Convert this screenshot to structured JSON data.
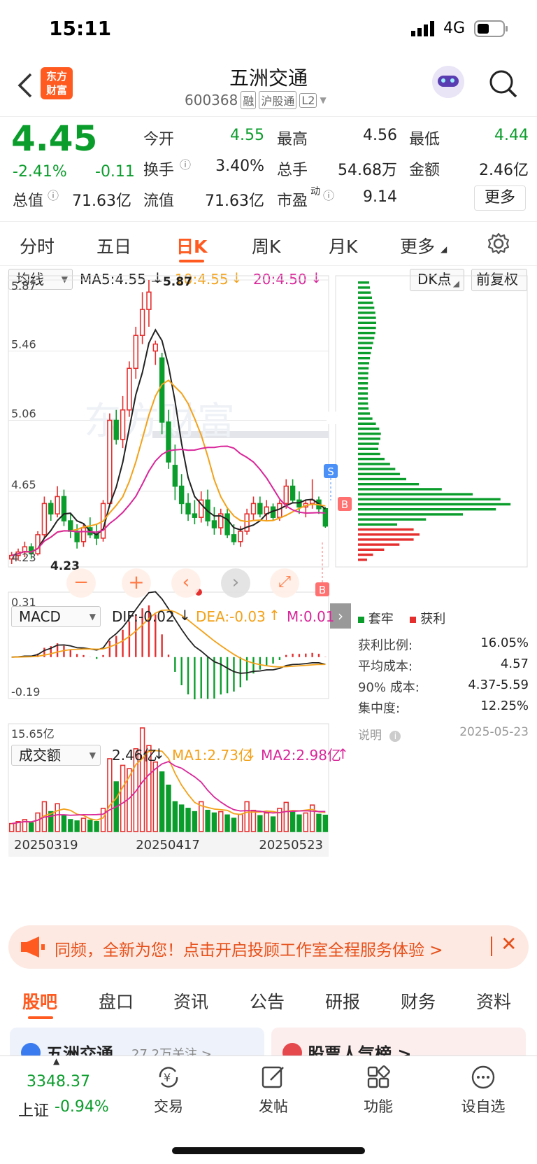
{
  "status": {
    "time": "15:11",
    "network": "4G"
  },
  "nav": {
    "title": "五洲交通",
    "code": "600368",
    "badges": [
      "融",
      "沪股通",
      "L2"
    ],
    "logo_text": "东方财富"
  },
  "quote": {
    "price": "4.45",
    "pct": "-2.41%",
    "chg": "-0.11",
    "fields": [
      {
        "label": "今开",
        "value": "4.55",
        "tone": "green"
      },
      {
        "label": "最高",
        "value": "4.56",
        "tone": "black"
      },
      {
        "label": "最低",
        "value": "4.44",
        "tone": "green"
      },
      {
        "label": "换手",
        "value": "3.40%",
        "tone": "black"
      },
      {
        "label": "总手",
        "value": "54.68万",
        "tone": "black"
      },
      {
        "label": "金额",
        "value": "2.46亿",
        "tone": "black"
      },
      {
        "label": "总值",
        "value": "71.63亿",
        "tone": "black"
      },
      {
        "label": "流值",
        "value": "71.63亿",
        "tone": "black"
      },
      {
        "label": "市盈",
        "sup": "动",
        "value": "9.14",
        "tone": "black"
      }
    ],
    "more_button": "更多"
  },
  "ktabs": [
    "分时",
    "五日",
    "日K",
    "周K",
    "月K",
    "更多"
  ],
  "ktabs_active": "日K",
  "ma": {
    "selector": "均线",
    "ma5": "MA5:4.55",
    "ma10": "10:4.55",
    "ma20": "20:4.50",
    "dk_label": "DK点",
    "adjust_label": "前复权",
    "y_labels": [
      "5.87",
      "5.46",
      "5.06",
      "4.65",
      "4.23"
    ],
    "high_mark": "5.87",
    "low_mark": "4.23",
    "signal_s": "S",
    "signal_b": "B",
    "watermark": "东方财富"
  },
  "macd": {
    "selector": "MACD",
    "dif": "DIF:-0.02",
    "dea": "DEA:-0.03",
    "m": "M:0.01",
    "y_top": "0.31",
    "y_bottom": "-0.19"
  },
  "volume": {
    "selector": "成交额",
    "value": "2.46亿",
    "ma1": "MA1:2.73亿",
    "ma2": "MA2:2.98亿",
    "y_top": "15.65亿",
    "dates": [
      "20250319",
      "20250417",
      "20250523"
    ]
  },
  "chips": {
    "legend_hold": "套牢",
    "legend_profit": "获利",
    "rows": [
      {
        "label": "获利比例:",
        "value": "16.05%"
      },
      {
        "label": "平均成本:",
        "value": "4.57"
      },
      {
        "label": "90% 成本:",
        "value": "4.37-5.59"
      },
      {
        "label": "集中度:",
        "value": "12.25%"
      }
    ],
    "note_label": "说明",
    "date": "2025-05-23"
  },
  "banner": {
    "text": "同频，全新为您！点击开启投顾工作室全程服务体验 >"
  },
  "bottom_tabs": [
    "股吧",
    "盘口",
    "资讯",
    "公告",
    "研报",
    "财务",
    "资料"
  ],
  "bottom_tabs_active": "股吧",
  "peek": {
    "left": "五洲交通",
    "left_sub": "27.2万关注 >",
    "right": "股票人气榜 >"
  },
  "tabbar": {
    "index_value": "3348.37",
    "index_name": "上证",
    "index_pct": "-0.94%",
    "items": [
      "交易",
      "发帖",
      "功能",
      "设自选"
    ]
  },
  "colors": {
    "up": "#e52f2f",
    "down": "#0b9d2c",
    "ma5": "#222222",
    "ma10": "#f3a21a",
    "ma20": "#d9279a",
    "accent": "#ff5a1f"
  },
  "chart_data": {
    "type": "candlestick",
    "ylim": [
      4.23,
      5.87
    ],
    "ohlc": [
      [
        4.26,
        4.3,
        4.23,
        4.28
      ],
      [
        4.28,
        4.32,
        4.25,
        4.3
      ],
      [
        4.3,
        4.36,
        4.27,
        4.33
      ],
      [
        4.33,
        4.35,
        4.26,
        4.29
      ],
      [
        4.29,
        4.42,
        4.28,
        4.4
      ],
      [
        4.4,
        4.62,
        4.38,
        4.58
      ],
      [
        4.58,
        4.6,
        4.48,
        4.52
      ],
      [
        4.52,
        4.68,
        4.5,
        4.62
      ],
      [
        4.62,
        4.66,
        4.45,
        4.48
      ],
      [
        4.48,
        4.52,
        4.38,
        4.42
      ],
      [
        4.42,
        4.46,
        4.32,
        4.36
      ],
      [
        4.36,
        4.46,
        4.33,
        4.44
      ],
      [
        4.44,
        4.5,
        4.38,
        4.4
      ],
      [
        4.4,
        4.46,
        4.34,
        4.38
      ],
      [
        4.38,
        4.6,
        4.36,
        4.58
      ],
      [
        4.58,
        5.1,
        4.56,
        5.06
      ],
      [
        5.06,
        5.12,
        4.92,
        4.95
      ],
      [
        4.95,
        5.2,
        4.9,
        5.12
      ],
      [
        5.12,
        5.4,
        5.08,
        5.36
      ],
      [
        5.36,
        5.6,
        5.3,
        5.55
      ],
      [
        5.55,
        5.8,
        5.5,
        5.7
      ],
      [
        5.7,
        5.87,
        5.6,
        5.8
      ],
      [
        5.46,
        5.52,
        5.38,
        5.5
      ],
      [
        5.42,
        5.45,
        4.98,
        5.05
      ],
      [
        5.05,
        5.12,
        4.78,
        4.82
      ],
      [
        4.8,
        4.92,
        4.6,
        4.68
      ],
      [
        4.68,
        4.75,
        4.52,
        4.58
      ],
      [
        4.58,
        4.64,
        4.48,
        4.52
      ],
      [
        4.52,
        4.6,
        4.46,
        4.5
      ],
      [
        4.5,
        4.65,
        4.47,
        4.6
      ],
      [
        4.6,
        4.66,
        4.45,
        4.48
      ],
      [
        4.48,
        4.56,
        4.4,
        4.44
      ],
      [
        4.44,
        4.55,
        4.4,
        4.52
      ],
      [
        4.52,
        4.55,
        4.38,
        4.4
      ],
      [
        4.4,
        4.46,
        4.34,
        4.36
      ],
      [
        4.36,
        4.45,
        4.33,
        4.42
      ],
      [
        4.42,
        4.55,
        4.4,
        4.52
      ],
      [
        4.52,
        4.62,
        4.48,
        4.58
      ],
      [
        4.58,
        4.62,
        4.5,
        4.52
      ],
      [
        4.52,
        4.6,
        4.48,
        4.56
      ],
      [
        4.56,
        4.58,
        4.48,
        4.5
      ],
      [
        4.5,
        4.6,
        4.48,
        4.58
      ],
      [
        4.58,
        4.72,
        4.55,
        4.68
      ],
      [
        4.68,
        4.72,
        4.58,
        4.6
      ],
      [
        4.6,
        4.65,
        4.52,
        4.56
      ],
      [
        4.56,
        4.6,
        4.5,
        4.58
      ],
      [
        4.58,
        4.72,
        4.55,
        4.6
      ],
      [
        4.6,
        4.62,
        4.52,
        4.55
      ],
      [
        4.55,
        4.56,
        4.44,
        4.45
      ]
    ],
    "volume_yi": [
      1.2,
      1.5,
      1.8,
      1.3,
      2.8,
      4.5,
      3.0,
      4.2,
      2.5,
      1.8,
      1.6,
      2.0,
      1.7,
      1.5,
      3.5,
      11.0,
      7.5,
      10.0,
      9.5,
      12.5,
      15.65,
      13.0,
      10.5,
      9.0,
      7.0,
      4.5,
      4.0,
      3.5,
      3.0,
      4.5,
      3.2,
      2.8,
      3.0,
      2.5,
      2.0,
      2.6,
      4.5,
      3.2,
      2.4,
      2.8,
      2.2,
      3.5,
      4.4,
      3.0,
      2.5,
      2.8,
      4.0,
      2.6,
      2.46
    ],
    "macd": {
      "dif_range": [
        -0.19,
        0.31
      ]
    },
    "dates": [
      "20250319",
      "20250417",
      "20250523"
    ]
  }
}
